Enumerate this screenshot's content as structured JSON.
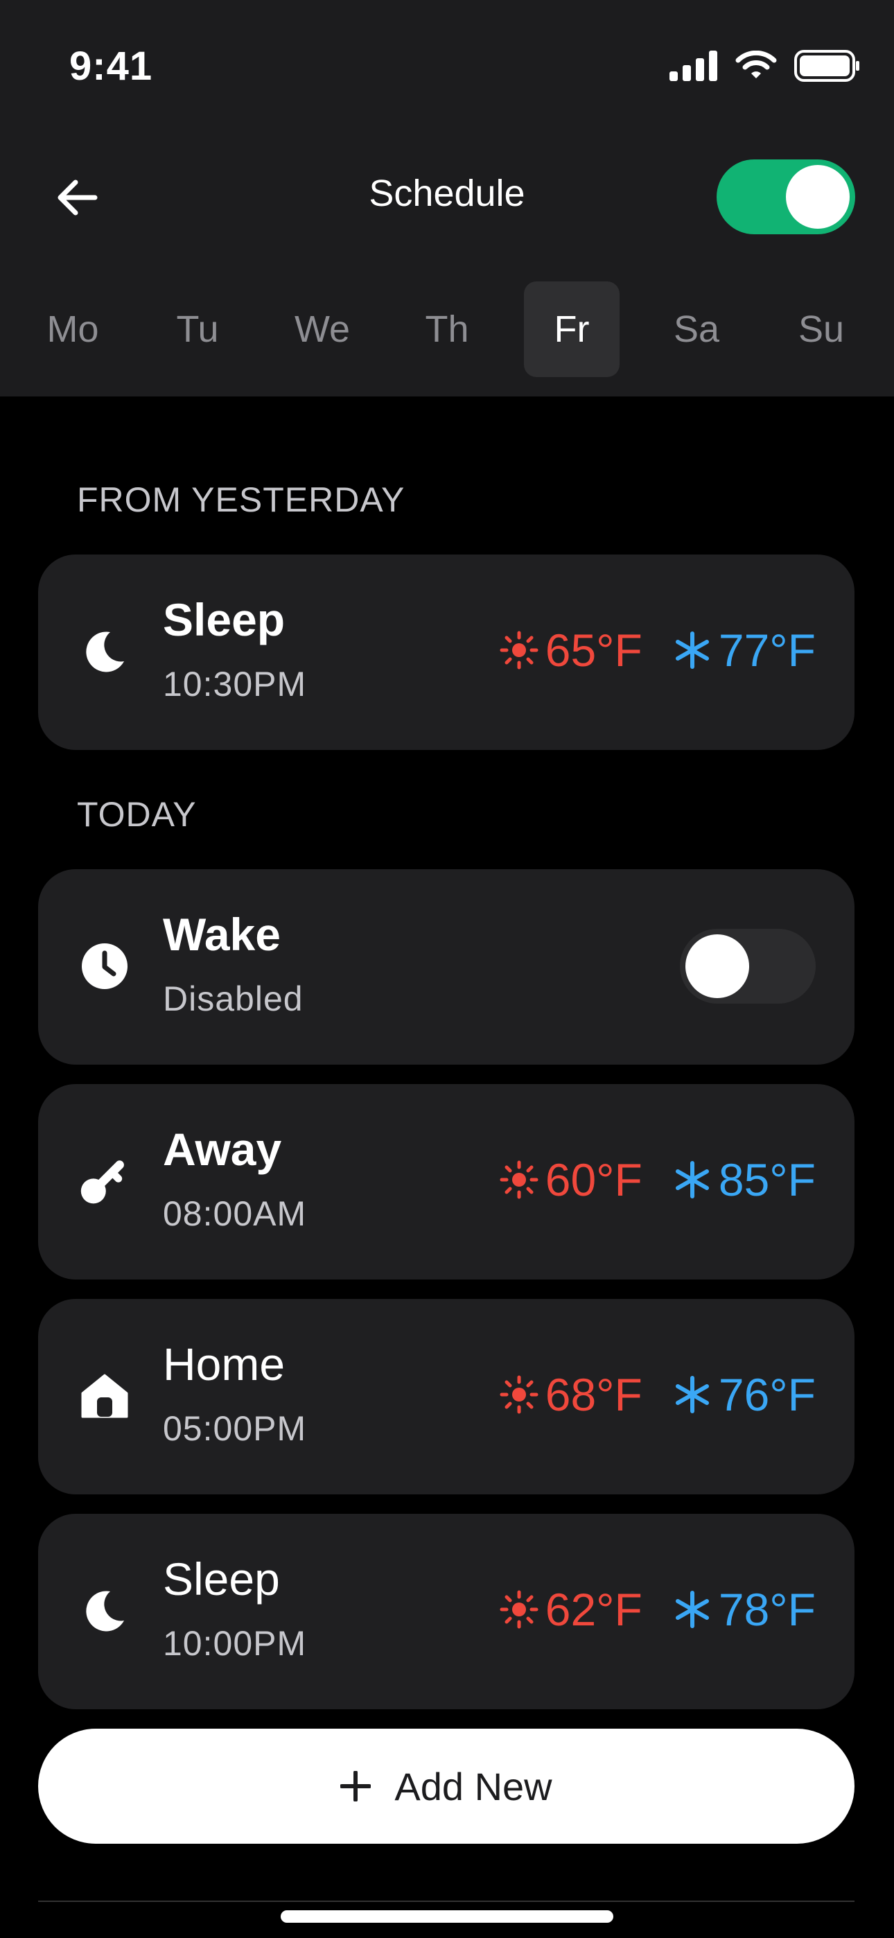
{
  "status_bar": {
    "time": "9:41"
  },
  "header": {
    "title": "Schedule",
    "schedule_enabled": true
  },
  "days": [
    "Mo",
    "Tu",
    "We",
    "Th",
    "Fr",
    "Sa",
    "Su"
  ],
  "selected_day": "Fr",
  "sections": {
    "yesterday_label": "FROM YESTERDAY",
    "today_label": "TODAY"
  },
  "yesterday_item": {
    "name": "Sleep",
    "time": "10:30PM",
    "heat": "65°F",
    "cool": "77°F",
    "icon": "moon-icon"
  },
  "today": {
    "wake": {
      "name": "Wake",
      "status": "Disabled",
      "enabled": false,
      "icon": "clock-icon"
    },
    "away": {
      "name": "Away",
      "time": "08:00AM",
      "heat": "60°F",
      "cool": "85°F",
      "icon": "key-icon"
    },
    "home": {
      "name": "Home",
      "time": "05:00PM",
      "heat": "68°F",
      "cool": "76°F",
      "icon": "home-icon"
    },
    "sleep": {
      "name": "Sleep",
      "time": "10:00PM",
      "heat": "62°F",
      "cool": "78°F",
      "icon": "moon-icon"
    }
  },
  "add_button": {
    "label": "Add New"
  },
  "colors": {
    "accent_green": "#11b373",
    "heat": "#f0483c",
    "cool": "#3aa7f5"
  }
}
